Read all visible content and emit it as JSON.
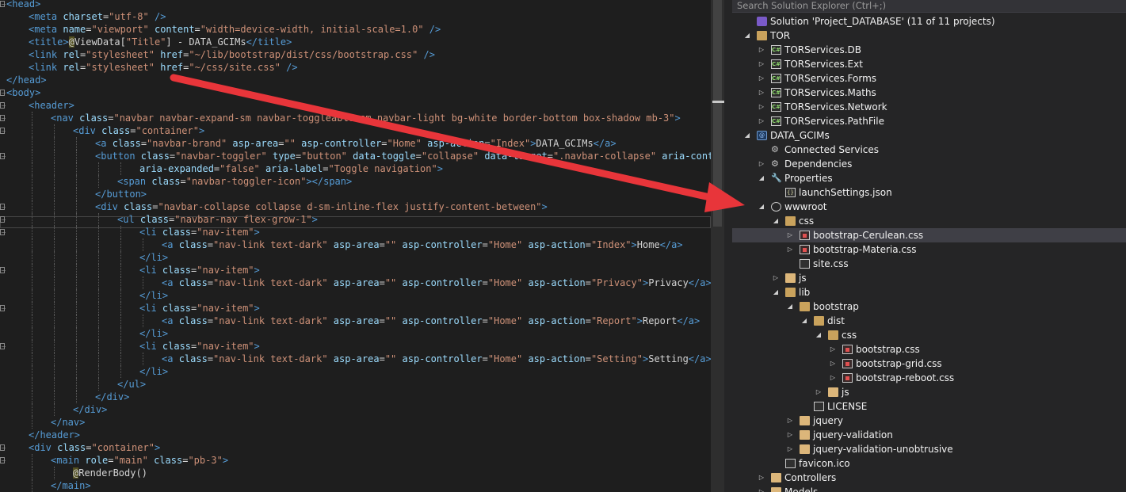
{
  "editor": {
    "lines": [
      [
        [
          "tg",
          "<head>"
        ]
      ],
      [
        [
          "tg",
          "<meta "
        ],
        [
          "at",
          "charset"
        ],
        [
          "tx",
          "="
        ],
        [
          "st",
          "\"utf-8\""
        ],
        [
          "tg",
          " />"
        ]
      ],
      [
        [
          "tg",
          "<meta "
        ],
        [
          "at",
          "name"
        ],
        [
          "tx",
          "="
        ],
        [
          "st",
          "\"viewport\""
        ],
        [
          "at",
          " content"
        ],
        [
          "tx",
          "="
        ],
        [
          "st",
          "\"width=device-width, initial-scale=1.0\""
        ],
        [
          "tg",
          " />"
        ]
      ],
      [
        [
          "tg",
          "<title>"
        ],
        [
          "razor",
          "@"
        ],
        [
          "sv",
          "ViewData["
        ],
        [
          "st",
          "\"Title\""
        ],
        [
          "sv",
          "]"
        ],
        [
          "tx",
          " - DATA_GCIMs"
        ],
        [
          "tg",
          "</title>"
        ]
      ],
      [
        [
          "tg",
          "<link "
        ],
        [
          "at",
          "rel"
        ],
        [
          "tx",
          "="
        ],
        [
          "st",
          "\"stylesheet\""
        ],
        [
          "at",
          " href"
        ],
        [
          "tx",
          "="
        ],
        [
          "st",
          "\"~/lib/bootstrap/dist/css/bootstrap.css\""
        ],
        [
          "tg",
          " />"
        ]
      ],
      [
        [
          "tg",
          "<link "
        ],
        [
          "at",
          "rel"
        ],
        [
          "tx",
          "="
        ],
        [
          "st",
          "\"stylesheet\""
        ],
        [
          "at",
          " href"
        ],
        [
          "tx",
          "="
        ],
        [
          "st",
          "\"~/css/site.css\""
        ],
        [
          "tg",
          " />"
        ]
      ],
      [
        [
          "tg",
          "</head>"
        ]
      ],
      [
        [
          "tg",
          "<body>"
        ]
      ],
      [
        [
          "tg",
          "<header>"
        ]
      ],
      [
        [
          "tg",
          "<nav "
        ],
        [
          "at",
          "class"
        ],
        [
          "tx",
          "="
        ],
        [
          "st",
          "\"navbar navbar-expand-sm navbar-toggleable-sm navbar-light bg-white border-bottom box-shadow mb-3\""
        ],
        [
          "tg",
          ">"
        ]
      ],
      [
        [
          "tg",
          "<div "
        ],
        [
          "at",
          "class"
        ],
        [
          "tx",
          "="
        ],
        [
          "st",
          "\"container\""
        ],
        [
          "tg",
          ">"
        ]
      ],
      [
        [
          "tg",
          "<a "
        ],
        [
          "at",
          "class"
        ],
        [
          "tx",
          "="
        ],
        [
          "st",
          "\"navbar-brand\""
        ],
        [
          "at",
          " asp-area"
        ],
        [
          "tx",
          "="
        ],
        [
          "st",
          "\"\""
        ],
        [
          "at",
          " asp-controller"
        ],
        [
          "tx",
          "="
        ],
        [
          "st",
          "\"Home\""
        ],
        [
          "at",
          " asp-action"
        ],
        [
          "tx",
          "="
        ],
        [
          "st",
          "\"Index\""
        ],
        [
          "tg",
          ">"
        ],
        [
          "tx",
          "DATA_GCIMs"
        ],
        [
          "tg",
          "</a>"
        ]
      ],
      [
        [
          "tg",
          "<button "
        ],
        [
          "at",
          "class"
        ],
        [
          "tx",
          "="
        ],
        [
          "st",
          "\"navbar-toggler\""
        ],
        [
          "at",
          " type"
        ],
        [
          "tx",
          "="
        ],
        [
          "st",
          "\"button\""
        ],
        [
          "at",
          " data-toggle"
        ],
        [
          "tx",
          "="
        ],
        [
          "st",
          "\"collapse\""
        ],
        [
          "at",
          " data-target"
        ],
        [
          "tx",
          "="
        ],
        [
          "st",
          "\".navbar-collapse\""
        ],
        [
          "at",
          " aria-controls"
        ]
      ],
      [
        [
          "at",
          "aria-expanded"
        ],
        [
          "tx",
          "="
        ],
        [
          "st",
          "\"false\""
        ],
        [
          "at",
          " aria-label"
        ],
        [
          "tx",
          "="
        ],
        [
          "st",
          "\"Toggle navigation\""
        ],
        [
          "tg",
          ">"
        ]
      ],
      [
        [
          "tg",
          "<span "
        ],
        [
          "at",
          "class"
        ],
        [
          "tx",
          "="
        ],
        [
          "st",
          "\"navbar-toggler-icon\""
        ],
        [
          "tg",
          "></span>"
        ]
      ],
      [
        [
          "tg",
          "</button>"
        ]
      ],
      [
        [
          "tg",
          "<div "
        ],
        [
          "at",
          "class"
        ],
        [
          "tx",
          "="
        ],
        [
          "st",
          "\"navbar-collapse collapse d-sm-inline-flex justify-content-between\""
        ],
        [
          "tg",
          ">"
        ]
      ],
      [
        [
          "tg",
          "<ul "
        ],
        [
          "at",
          "class"
        ],
        [
          "tx",
          "="
        ],
        [
          "st",
          "\"navbar-nav flex-grow-1\""
        ],
        [
          "tg",
          ">"
        ]
      ],
      [
        [
          "tg",
          "<li "
        ],
        [
          "at",
          "class"
        ],
        [
          "tx",
          "="
        ],
        [
          "st",
          "\"nav-item\""
        ],
        [
          "tg",
          ">"
        ]
      ],
      [
        [
          "tg",
          "<a "
        ],
        [
          "at",
          "class"
        ],
        [
          "tx",
          "="
        ],
        [
          "st",
          "\"nav-link text-dark\""
        ],
        [
          "at",
          " asp-area"
        ],
        [
          "tx",
          "="
        ],
        [
          "st",
          "\"\""
        ],
        [
          "at",
          " asp-controller"
        ],
        [
          "tx",
          "="
        ],
        [
          "st",
          "\"Home\""
        ],
        [
          "at",
          " asp-action"
        ],
        [
          "tx",
          "="
        ],
        [
          "st",
          "\"Index\""
        ],
        [
          "tg",
          ">"
        ],
        [
          "tx",
          "Home"
        ],
        [
          "tg",
          "</a>"
        ]
      ],
      [
        [
          "tg",
          "</li>"
        ]
      ],
      [
        [
          "tg",
          "<li "
        ],
        [
          "at",
          "class"
        ],
        [
          "tx",
          "="
        ],
        [
          "st",
          "\"nav-item\""
        ],
        [
          "tg",
          ">"
        ]
      ],
      [
        [
          "tg",
          "<a "
        ],
        [
          "at",
          "class"
        ],
        [
          "tx",
          "="
        ],
        [
          "st",
          "\"nav-link text-dark\""
        ],
        [
          "at",
          " asp-area"
        ],
        [
          "tx",
          "="
        ],
        [
          "st",
          "\"\""
        ],
        [
          "at",
          " asp-controller"
        ],
        [
          "tx",
          "="
        ],
        [
          "st",
          "\"Home\""
        ],
        [
          "at",
          " asp-action"
        ],
        [
          "tx",
          "="
        ],
        [
          "st",
          "\"Privacy\""
        ],
        [
          "tg",
          ">"
        ],
        [
          "tx",
          "Privacy"
        ],
        [
          "tg",
          "</a>"
        ]
      ],
      [
        [
          "tg",
          "</li>"
        ]
      ],
      [
        [
          "tg",
          "<li "
        ],
        [
          "at",
          "class"
        ],
        [
          "tx",
          "="
        ],
        [
          "st",
          "\"nav-item\""
        ],
        [
          "tg",
          ">"
        ]
      ],
      [
        [
          "tg",
          "<a "
        ],
        [
          "at",
          "class"
        ],
        [
          "tx",
          "="
        ],
        [
          "st",
          "\"nav-link text-dark\""
        ],
        [
          "at",
          " asp-area"
        ],
        [
          "tx",
          "="
        ],
        [
          "st",
          "\"\""
        ],
        [
          "at",
          " asp-controller"
        ],
        [
          "tx",
          "="
        ],
        [
          "st",
          "\"Home\""
        ],
        [
          "at",
          " asp-action"
        ],
        [
          "tx",
          "="
        ],
        [
          "st",
          "\"Report\""
        ],
        [
          "tg",
          ">"
        ],
        [
          "tx",
          "Report"
        ],
        [
          "tg",
          "</a>"
        ]
      ],
      [
        [
          "tg",
          "</li>"
        ]
      ],
      [
        [
          "tg",
          "<li "
        ],
        [
          "at",
          "class"
        ],
        [
          "tx",
          "="
        ],
        [
          "st",
          "\"nav-item\""
        ],
        [
          "tg",
          ">"
        ]
      ],
      [
        [
          "tg",
          "<a "
        ],
        [
          "at",
          "class"
        ],
        [
          "tx",
          "="
        ],
        [
          "st",
          "\"nav-link text-dark\""
        ],
        [
          "at",
          " asp-area"
        ],
        [
          "tx",
          "="
        ],
        [
          "st",
          "\"\""
        ],
        [
          "at",
          " asp-controller"
        ],
        [
          "tx",
          "="
        ],
        [
          "st",
          "\"Home\""
        ],
        [
          "at",
          " asp-action"
        ],
        [
          "tx",
          "="
        ],
        [
          "st",
          "\"Setting\""
        ],
        [
          "tg",
          ">"
        ],
        [
          "tx",
          "Setting"
        ],
        [
          "tg",
          "</a>"
        ]
      ],
      [
        [
          "tg",
          "</li>"
        ]
      ],
      [
        [
          "tg",
          "</ul>"
        ]
      ],
      [
        [
          "tg",
          "</div>"
        ]
      ],
      [
        [
          "tg",
          "</div>"
        ]
      ],
      [
        [
          "tg",
          "</nav>"
        ]
      ],
      [
        [
          "tg",
          "</header>"
        ]
      ],
      [
        [
          "tg",
          "<div "
        ],
        [
          "at",
          "class"
        ],
        [
          "tx",
          "="
        ],
        [
          "st",
          "\"container\""
        ],
        [
          "tg",
          ">"
        ]
      ],
      [
        [
          "tg",
          "<main "
        ],
        [
          "at",
          "role"
        ],
        [
          "tx",
          "="
        ],
        [
          "st",
          "\"main\""
        ],
        [
          "at",
          " class"
        ],
        [
          "tx",
          "="
        ],
        [
          "st",
          "\"pb-3\""
        ],
        [
          "tg",
          ">"
        ]
      ],
      [
        [
          "razor",
          "@"
        ],
        [
          "sv",
          "RenderBody()"
        ]
      ],
      [
        [
          "tg",
          "</main>"
        ]
      ]
    ]
  },
  "solution_explorer": {
    "search_placeholder": "Search Solution Explorer (Ctrl+;)",
    "items": [
      {
        "label": "Solution 'Project_DATABASE' (11 of 11 projects)",
        "icon": "solution-icon",
        "exp": "none"
      },
      {
        "label": "TOR",
        "icon": "folder-icon",
        "exp": "open"
      },
      {
        "label": "TORServices.DB",
        "icon": "csharp-project-icon",
        "exp": "closed"
      },
      {
        "label": "TORServices.Ext",
        "icon": "csharp-project-icon",
        "exp": "closed"
      },
      {
        "label": "TORServices.Forms",
        "icon": "csharp-project-icon",
        "exp": "closed"
      },
      {
        "label": "TORServices.Maths",
        "icon": "csharp-project-icon",
        "exp": "closed"
      },
      {
        "label": "TORServices.Network",
        "icon": "csharp-project-icon",
        "exp": "closed"
      },
      {
        "label": "TORServices.PathFile",
        "icon": "csharp-project-icon",
        "exp": "closed"
      },
      {
        "label": "DATA_GCIMs",
        "icon": "web-project-icon",
        "exp": "open"
      },
      {
        "label": "Connected Services",
        "icon": "connected-services-icon",
        "exp": "none"
      },
      {
        "label": "Dependencies",
        "icon": "dependencies-icon",
        "exp": "closed"
      },
      {
        "label": "Properties",
        "icon": "wrench-icon",
        "exp": "open"
      },
      {
        "label": "launchSettings.json",
        "icon": "json-file-icon",
        "exp": "none"
      },
      {
        "label": "wwwroot",
        "icon": "globe-icon",
        "exp": "open"
      },
      {
        "label": "css",
        "icon": "folder-icon",
        "exp": "open"
      },
      {
        "label": "bootstrap-Cerulean.css",
        "icon": "css-file-icon",
        "exp": "closed",
        "selected": true
      },
      {
        "label": "bootstrap-Materia.css",
        "icon": "css-file-icon",
        "exp": "closed"
      },
      {
        "label": "site.css",
        "icon": "file-icon",
        "exp": "none"
      },
      {
        "label": "js",
        "icon": "folder-icon",
        "exp": "closed"
      },
      {
        "label": "lib",
        "icon": "folder-icon",
        "exp": "open"
      },
      {
        "label": "bootstrap",
        "icon": "folder-icon",
        "exp": "open"
      },
      {
        "label": "dist",
        "icon": "folder-icon",
        "exp": "open"
      },
      {
        "label": "css",
        "icon": "folder-icon",
        "exp": "open"
      },
      {
        "label": "bootstrap.css",
        "icon": "css-file-icon",
        "exp": "closed"
      },
      {
        "label": "bootstrap-grid.css",
        "icon": "css-file-icon",
        "exp": "closed"
      },
      {
        "label": "bootstrap-reboot.css",
        "icon": "css-file-icon",
        "exp": "closed"
      },
      {
        "label": "js",
        "icon": "folder-icon",
        "exp": "closed"
      },
      {
        "label": "LICENSE",
        "icon": "file-icon",
        "exp": "none"
      },
      {
        "label": "jquery",
        "icon": "folder-icon",
        "exp": "closed"
      },
      {
        "label": "jquery-validation",
        "icon": "folder-icon",
        "exp": "closed"
      },
      {
        "label": "jquery-validation-unobtrusive",
        "icon": "folder-icon",
        "exp": "closed"
      },
      {
        "label": "favicon.ico",
        "icon": "file-icon",
        "exp": "none"
      },
      {
        "label": "Controllers",
        "icon": "folder-icon",
        "exp": "closed"
      },
      {
        "label": "Models",
        "icon": "folder-icon",
        "exp": "closed"
      }
    ]
  },
  "colors": {
    "arrow": "#e8353a",
    "tag": "#569cd6",
    "attr": "#9cdcfe",
    "string": "#ce9178"
  }
}
